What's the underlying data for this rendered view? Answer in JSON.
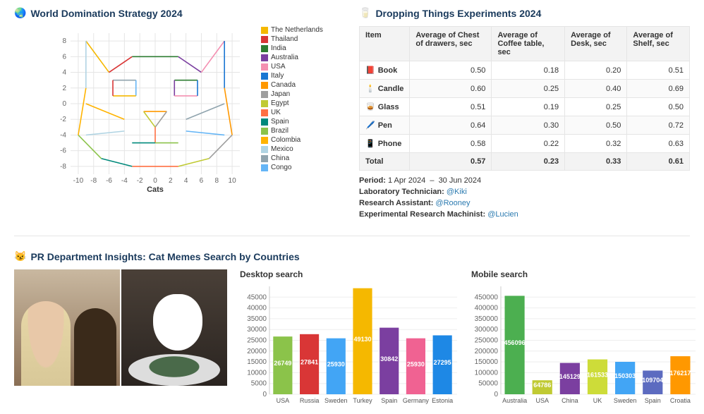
{
  "panel1": {
    "title": "World Domination Strategy 2024",
    "icon": "🌏",
    "xaxis_label": "Cats",
    "legend": [
      {
        "label": "The Netherlands",
        "color": "#f5b800"
      },
      {
        "label": "Thailand",
        "color": "#d93636"
      },
      {
        "label": "India",
        "color": "#2e7d32"
      },
      {
        "label": "Australia",
        "color": "#7b3fa0"
      },
      {
        "label": "USA",
        "color": "#f48fb1"
      },
      {
        "label": "Italy",
        "color": "#1976d2"
      },
      {
        "label": "Canada",
        "color": "#ff9800"
      },
      {
        "label": "Japan",
        "color": "#9e9e9e"
      },
      {
        "label": "Egypt",
        "color": "#c0ca33"
      },
      {
        "label": "UK",
        "color": "#ff7043"
      },
      {
        "label": "Spain",
        "color": "#00897b"
      },
      {
        "label": "Brazil",
        "color": "#8bc34a"
      },
      {
        "label": "Colombia",
        "color": "#ffb300"
      },
      {
        "label": "Mexico",
        "color": "#b0d4e3"
      },
      {
        "label": "China",
        "color": "#90a4ae"
      },
      {
        "label": "Congo",
        "color": "#64b5f6"
      }
    ]
  },
  "panel2": {
    "title": "Dropping Things Experiments 2024",
    "icon": "🥛",
    "headers": [
      "Item",
      "Average of Chest of drawers, sec",
      "Average of Coffee table, sec",
      "Average of Desk, sec",
      "Average of Shelf, sec"
    ],
    "rows": [
      {
        "icon": "📕",
        "name": "Book",
        "v": [
          "0.50",
          "0.18",
          "0.20",
          "0.51"
        ]
      },
      {
        "icon": "🕯️",
        "name": "Candle",
        "v": [
          "0.60",
          "0.25",
          "0.40",
          "0.69"
        ]
      },
      {
        "icon": "🥃",
        "name": "Glass",
        "v": [
          "0.51",
          "0.19",
          "0.25",
          "0.50"
        ]
      },
      {
        "icon": "🖊️",
        "name": "Pen",
        "v": [
          "0.64",
          "0.30",
          "0.50",
          "0.72"
        ]
      },
      {
        "icon": "📱",
        "name": "Phone",
        "v": [
          "0.58",
          "0.22",
          "0.32",
          "0.63"
        ]
      }
    ],
    "total": {
      "name": "Total",
      "v": [
        "0.57",
        "0.23",
        "0.33",
        "0.61"
      ]
    },
    "period_label": "Period:",
    "period_from": "1 Apr 2024",
    "period_sep": "–",
    "period_to": "30 Jun 2024",
    "roles": [
      {
        "label": "Laboratory Technician:",
        "user": "@Kiki"
      },
      {
        "label": "Research Assistant:",
        "user": "@Rooney"
      },
      {
        "label": "Experimental Research Machinist:",
        "user": "@Lucien"
      }
    ]
  },
  "panel3": {
    "title": "PR Department Insights: Cat Memes Search by Countries",
    "icon": "😼"
  },
  "chart_data": [
    {
      "type": "bar",
      "title": "Desktop search",
      "categories": [
        "USA",
        "Russia",
        "Sweden",
        "Turkey",
        "Spain",
        "Germany",
        "Estonia"
      ],
      "values": [
        26749,
        27841,
        25930,
        49130,
        30842,
        25930,
        27295
      ],
      "colors": [
        "#8bc34a",
        "#d93636",
        "#42a5f5",
        "#f5b800",
        "#7b3fa0",
        "#f06292",
        "#1e88e5"
      ],
      "ylim": [
        0,
        50000
      ],
      "ticks": [
        0,
        5000,
        10000,
        15000,
        20000,
        25000,
        30000,
        35000,
        40000,
        45000
      ]
    },
    {
      "type": "bar",
      "title": "Mobile search",
      "categories": [
        "Australia",
        "USA",
        "China",
        "UK",
        "Sweden",
        "Spain",
        "Croatia"
      ],
      "values": [
        456096,
        64786,
        145129,
        161533,
        150303,
        109704,
        176217
      ],
      "colors": [
        "#4caf50",
        "#c0ca33",
        "#7b3fa0",
        "#cddc39",
        "#42a5f5",
        "#5c6bc0",
        "#ff9800"
      ],
      "ylim": [
        0,
        500000
      ],
      "ticks": [
        0,
        50000,
        100000,
        150000,
        200000,
        250000,
        300000,
        350000,
        400000,
        450000
      ]
    }
  ]
}
